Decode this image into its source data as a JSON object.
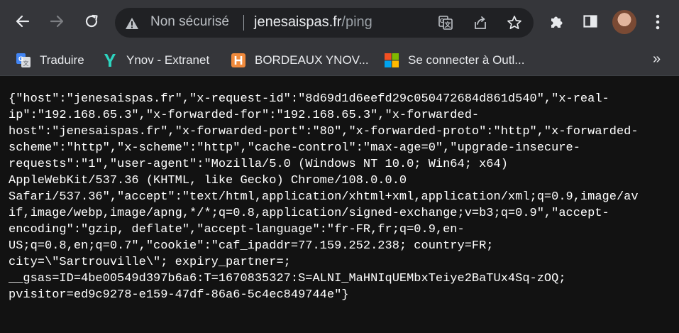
{
  "omnibox": {
    "security_label": "Non sécurisé",
    "url_host": "jenesaispas.fr",
    "url_path": "/ping"
  },
  "bookmarks": [
    {
      "label": "Traduire",
      "icon": "google-translate-icon"
    },
    {
      "label": "Ynov - Extranet",
      "icon": "ynov-icon"
    },
    {
      "label": "BORDEAUX YNOV...",
      "icon": "hyperplanning-icon"
    },
    {
      "label": "Se connecter à Outl...",
      "icon": "microsoft-icon"
    }
  ],
  "overflow_label": "»",
  "response_lines": [
    "{\"host\":\"jenesaispas.fr\",\"x-request-id\":\"8d69d1d6eefd29c050472684d861d540\",\"x-real-",
    "ip\":\"192.168.65.3\",\"x-forwarded-for\":\"192.168.65.3\",\"x-forwarded-",
    "host\":\"jenesaispas.fr\",\"x-forwarded-port\":\"80\",\"x-forwarded-proto\":\"http\",\"x-forwarded-",
    "scheme\":\"http\",\"x-scheme\":\"http\",\"cache-control\":\"max-age=0\",\"upgrade-insecure-",
    "requests\":\"1\",\"user-agent\":\"Mozilla/5.0 (Windows NT 10.0; Win64; x64)",
    "AppleWebKit/537.36 (KHTML, like Gecko) Chrome/108.0.0.0",
    "Safari/537.36\",\"accept\":\"text/html,application/xhtml+xml,application/xml;q=0.9,image/av",
    "if,image/webp,image/apng,*/*;q=0.8,application/signed-exchange;v=b3;q=0.9\",\"accept-",
    "encoding\":\"gzip, deflate\",\"accept-language\":\"fr-FR,fr;q=0.9,en-",
    "US;q=0.8,en;q=0.7\",\"cookie\":\"caf_ipaddr=77.159.252.238; country=FR;",
    "city=\\\"Sartrouville\\\"; expiry_partner=;",
    "__gsas=ID=4be00549d397b6a6:T=1670835327:S=ALNI_MaHNIqUEMbxTeiye2BaTUx4Sq-zOQ;",
    "pvisitor=ed9c9278-e159-47df-86a6-5c4ec849744e\"}"
  ]
}
